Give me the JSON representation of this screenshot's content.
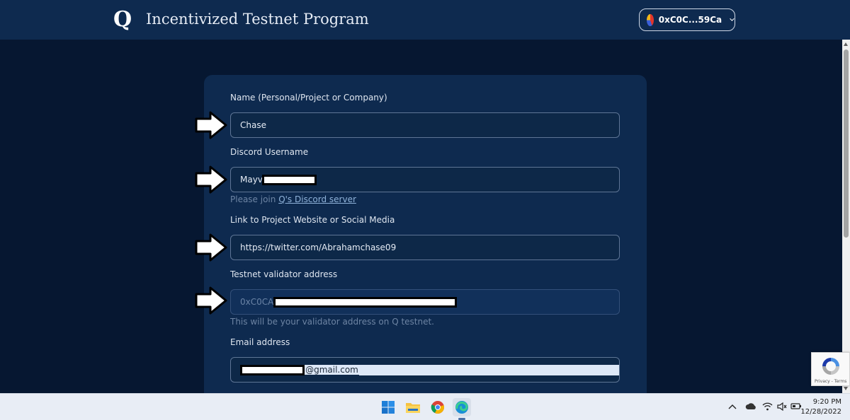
{
  "header": {
    "logo": "Q",
    "title": "Incentivized Testnet Program",
    "wallet": {
      "address": "0xC0C...59Ca"
    }
  },
  "form": {
    "name": {
      "label": "Name (Personal/Project or Company)",
      "value": "Chase"
    },
    "discord": {
      "label": "Discord Username",
      "value": "Mayve",
      "helper_prefix": "Please join ",
      "helper_link": "Q's Discord server"
    },
    "link": {
      "label": "Link to Project Website or Social Media",
      "value": "https://twitter.com/Abrahamchase09"
    },
    "validator": {
      "label": "Testnet validator address",
      "value": "0xC0CA5",
      "helper": "This will be your validator address on Q testnet."
    },
    "email": {
      "label": "Email address",
      "value": "@gmail.com"
    }
  },
  "recaptcha": {
    "text": "Privacy - Terms"
  },
  "taskbar": {
    "apps": [
      "start-icon",
      "file-explorer-icon",
      "chrome-icon",
      "edge-icon"
    ],
    "clock": {
      "time": "9:20 PM",
      "date": "12/28/2022"
    }
  },
  "colors": {
    "page_bg": "#061731",
    "header_bg": "#0e2a4f",
    "card_bg": "#0e2a4f",
    "field_border": "#5e7595",
    "link": "#8fb2d9"
  }
}
